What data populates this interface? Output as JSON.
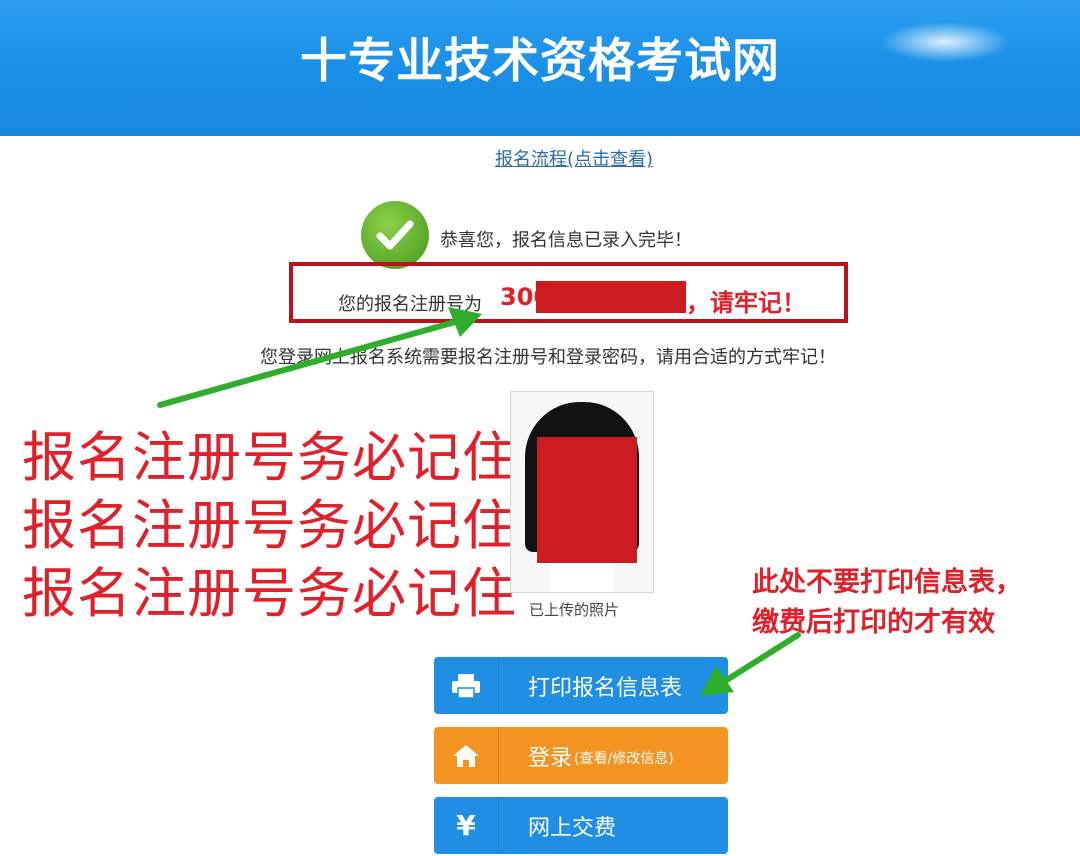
{
  "header": {
    "site_title": "十专业技术资格考试网"
  },
  "process_link": {
    "label": "报名流程(点击查看)"
  },
  "success": {
    "message": "恭喜您，报名信息已录入完毕！"
  },
  "registration": {
    "prefix": "您的报名注册号为",
    "number_visible": "300",
    "suffix": "，请牢记！"
  },
  "login_note": "您登录网上报名系统需要报名注册号和登录密码，请用合适的方式牢记！",
  "warnings": [
    "报名注册号务必记住",
    "报名注册号务必记住",
    "报名注册号务必记住"
  ],
  "photo": {
    "caption": "已上传的照片"
  },
  "print_note": [
    "此处不要打印信息表，",
    "缴费后打印的才有效"
  ],
  "actions": {
    "print": {
      "label": "打印报名信息表",
      "icon": "printer-icon"
    },
    "login": {
      "label": "登录",
      "sub_label": "(查看/修改信息)",
      "icon": "home-icon"
    },
    "pay": {
      "label": "网上交费",
      "icon": "yen-icon",
      "icon_glyph": "¥"
    }
  },
  "colors": {
    "banner_blue": "#1a8ee6",
    "annotation_red": "#e0212a",
    "arrow_green": "#2fae2c",
    "button_blue": "#1f8ee3",
    "button_orange": "#f39422"
  }
}
